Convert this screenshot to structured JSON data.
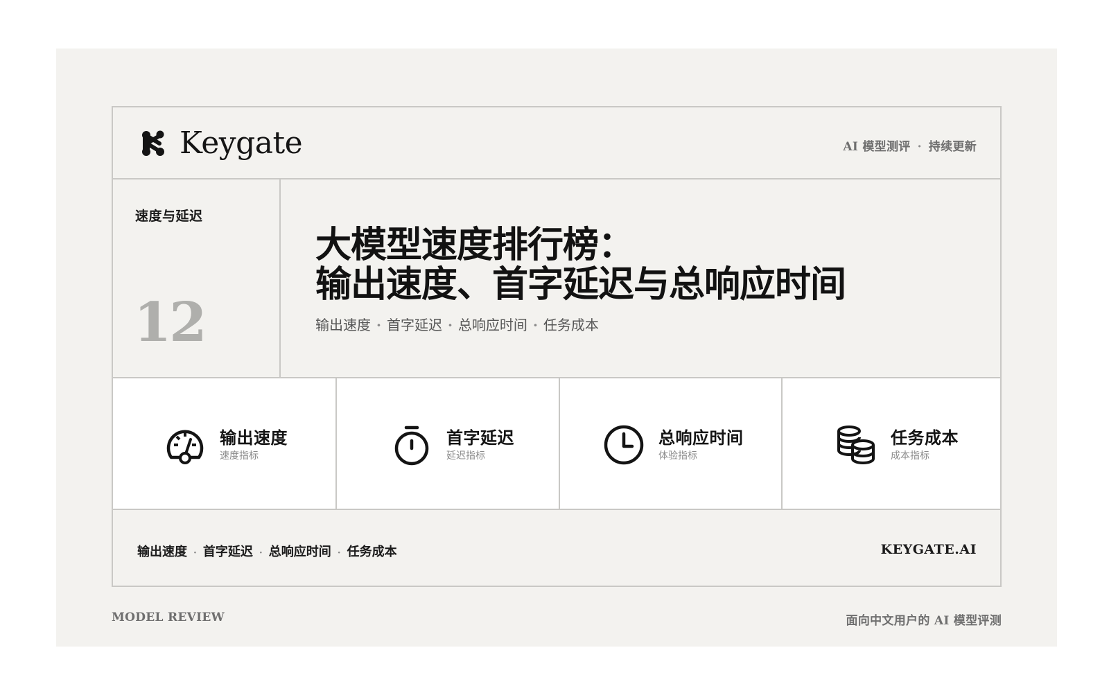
{
  "brand": {
    "name": "Keygate",
    "logo_icon": "keygate-logo-icon"
  },
  "header": {
    "meta": [
      "AI 模型测评",
      "持续更新"
    ]
  },
  "section": {
    "tag": "速度与延迟",
    "number": "12"
  },
  "hero": {
    "title_line1": "大模型速度排行榜：",
    "title_line2": "输出速度、首字延迟与总响应时间",
    "subtitle_items": [
      "输出速度",
      "首字延迟",
      "总响应时间",
      "任务成本"
    ]
  },
  "metrics": [
    {
      "icon": "speedometer-icon",
      "title": "输出速度",
      "subtitle": "速度指标"
    },
    {
      "icon": "stopwatch-icon",
      "title": "首字延迟",
      "subtitle": "延迟指标"
    },
    {
      "icon": "clock-icon",
      "title": "总响应时间",
      "subtitle": "体验指标"
    },
    {
      "icon": "coins-icon",
      "title": "任务成本",
      "subtitle": "成本指标"
    }
  ],
  "footer": {
    "tags": [
      "输出速度",
      "首字延迟",
      "总响应时间",
      "任务成本"
    ],
    "site": "KEYGATE.AI"
  },
  "outer": {
    "left": "MODEL REVIEW",
    "right": "面向中文用户的 AI 模型评测"
  },
  "colors": {
    "background": "#f3f2ef",
    "card_border": "#c9c8c5",
    "text_primary": "#141414",
    "text_muted": "#6f6f6f",
    "number_gray": "#afafac"
  }
}
